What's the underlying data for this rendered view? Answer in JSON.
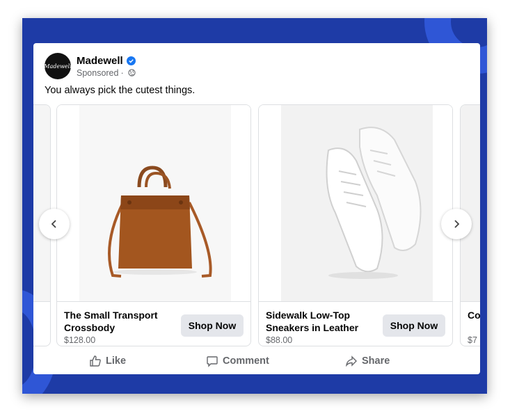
{
  "post": {
    "page_name": "Madewell",
    "avatar_text": "Madewell",
    "sponsored_label": "Sponsored",
    "sponsored_separator": "·",
    "message": "You always pick the cutest things."
  },
  "carousel": {
    "items": [
      {
        "title": "The Small Transport Crossbody",
        "price": "$128.00",
        "cta": "Shop Now"
      },
      {
        "title": "Sidewalk Low-Top Sneakers in Leather",
        "price": "$88.00",
        "cta": "Shop Now"
      },
      {
        "title": "Co Co",
        "price": "$7"
      }
    ]
  },
  "actions": {
    "like": "Like",
    "comment": "Comment",
    "share": "Share"
  },
  "icons": {
    "verified": "verified-badge-icon",
    "globe": "globe-icon",
    "prev": "chevron-left-icon",
    "next": "chevron-right-icon",
    "like": "thumbs-up-icon",
    "comment": "comment-bubble-icon",
    "share": "share-arrow-icon"
  },
  "colors": {
    "frame_blue": "#1e3ba6",
    "accent_blue": "#2f56d6",
    "verified_blue": "#1877f2",
    "button_gray": "#e4e6eb",
    "text_secondary": "#65676b"
  }
}
